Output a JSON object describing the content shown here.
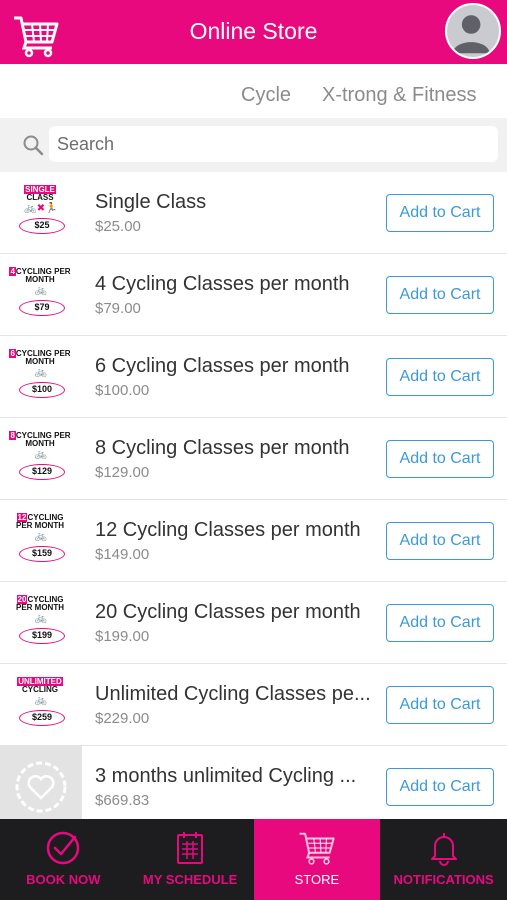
{
  "header": {
    "title": "Online Store",
    "brand_color": "#e8097e",
    "cart_icon": "shopping-cart-icon",
    "avatar_icon": "user-avatar-icon"
  },
  "tabs": [
    {
      "label": "Cycle"
    },
    {
      "label": "X-trong & Fitness"
    }
  ],
  "search": {
    "placeholder": "Search",
    "value": ""
  },
  "products": [
    {
      "name": "Single Class",
      "price": "$25.00",
      "button": "Add to Cart",
      "thumb": {
        "top_hl": "SINGLE",
        "top_rest": "CLASS",
        "price": "$25"
      }
    },
    {
      "name": "4 Cycling Classes per month",
      "price": "$79.00",
      "button": "Add to Cart",
      "thumb": {
        "top_hl": "4",
        "top_rest": "CYCLING PER MONTH",
        "price": "$79"
      }
    },
    {
      "name": "6 Cycling Classes per month",
      "price": "$100.00",
      "button": "Add to Cart",
      "thumb": {
        "top_hl": "6",
        "top_rest": "CYCLING PER MONTH",
        "price": "$100"
      }
    },
    {
      "name": "8 Cycling Classes per month",
      "price": "$129.00",
      "button": "Add to Cart",
      "thumb": {
        "top_hl": "8",
        "top_rest": "CYCLING PER MONTH",
        "price": "$129"
      }
    },
    {
      "name": "12 Cycling Classes per month",
      "price": "$149.00",
      "button": "Add to Cart",
      "thumb": {
        "top_hl": "12",
        "top_rest": "CYCLING PER MONTH",
        "price": "$159"
      }
    },
    {
      "name": "20 Cycling Classes per month",
      "price": "$199.00",
      "button": "Add to Cart",
      "thumb": {
        "top_hl": "20",
        "top_rest": "CYCLING PER MONTH",
        "price": "$199"
      }
    },
    {
      "name": "Unlimited Cycling Classes pe...",
      "price": "$229.00",
      "button": "Add to Cart",
      "thumb": {
        "top_hl": "UNLIMITED",
        "top_rest": "CYCLING",
        "price": "$259"
      }
    },
    {
      "name": "3 months unlimited Cycling ...",
      "price": "$669.83",
      "button": "Add to Cart"
    }
  ],
  "bottom_nav": [
    {
      "label": "BOOK NOW",
      "icon": "check-circle-icon"
    },
    {
      "label": "MY SCHEDULE",
      "icon": "calendar-icon"
    },
    {
      "label": "STORE",
      "icon": "shopping-cart-icon",
      "active": true
    },
    {
      "label": "NOTIFICATIONS",
      "icon": "bell-icon"
    }
  ]
}
